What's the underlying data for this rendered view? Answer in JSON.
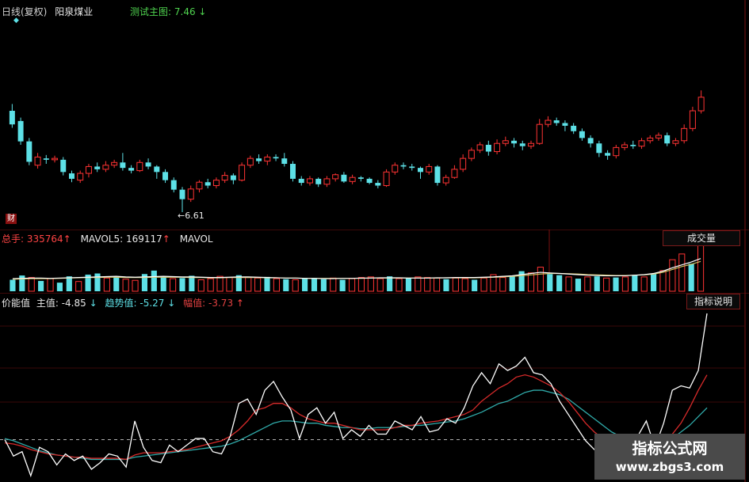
{
  "header": {
    "period_label": "日线(复权)",
    "stock_name": "阳泉煤业",
    "test_label": "测试主图:",
    "test_value": "7.46",
    "test_arrow": "↓"
  },
  "main_chart": {
    "low_marker": "←6.61",
    "cai_badge": "财",
    "candles": [
      [
        8.1,
        7.9,
        8.2,
        7.85
      ],
      [
        7.95,
        7.65,
        8.0,
        7.6
      ],
      [
        7.65,
        7.35,
        7.7,
        7.3
      ],
      [
        7.3,
        7.42,
        7.48,
        7.25
      ],
      [
        7.4,
        7.38,
        7.45,
        7.32
      ],
      [
        7.38,
        7.4,
        7.44,
        7.34
      ],
      [
        7.38,
        7.2,
        7.42,
        7.15
      ],
      [
        7.18,
        7.1,
        7.22,
        7.05
      ],
      [
        7.08,
        7.18,
        7.22,
        7.04
      ],
      [
        7.18,
        7.28,
        7.32,
        7.12
      ],
      [
        7.28,
        7.24,
        7.34,
        7.2
      ],
      [
        7.24,
        7.3,
        7.36,
        7.2
      ],
      [
        7.3,
        7.34,
        7.38,
        7.26
      ],
      [
        7.34,
        7.26,
        7.48,
        7.22
      ],
      [
        7.26,
        7.22,
        7.3,
        7.18
      ],
      [
        7.22,
        7.34,
        7.38,
        7.2
      ],
      [
        7.34,
        7.28,
        7.4,
        7.24
      ],
      [
        7.28,
        7.2,
        7.3,
        7.1
      ],
      [
        7.2,
        7.08,
        7.24,
        7.04
      ],
      [
        7.08,
        6.94,
        7.12,
        6.9
      ],
      [
        6.94,
        6.8,
        6.98,
        6.61
      ],
      [
        6.8,
        6.95,
        7.0,
        6.76
      ],
      [
        6.95,
        7.05,
        7.08,
        6.9
      ],
      [
        7.05,
        7.0,
        7.1,
        6.96
      ],
      [
        7.0,
        7.08,
        7.12,
        6.96
      ],
      [
        7.08,
        7.15,
        7.2,
        7.04
      ],
      [
        7.15,
        7.08,
        7.18,
        7.02
      ],
      [
        7.08,
        7.3,
        7.34,
        7.06
      ],
      [
        7.3,
        7.4,
        7.44,
        7.26
      ],
      [
        7.4,
        7.36,
        7.46,
        7.32
      ],
      [
        7.36,
        7.42,
        7.46,
        7.3
      ],
      [
        7.42,
        7.4,
        7.46,
        7.36
      ],
      [
        7.4,
        7.32,
        7.48,
        7.28
      ],
      [
        7.32,
        7.1,
        7.36,
        7.06
      ],
      [
        7.1,
        7.04,
        7.14,
        7.0
      ],
      [
        7.04,
        7.1,
        7.14,
        7.0
      ],
      [
        7.1,
        7.02,
        7.12,
        6.98
      ],
      [
        7.02,
        7.1,
        7.14,
        6.98
      ],
      [
        7.1,
        7.16,
        7.18,
        7.06
      ],
      [
        7.16,
        7.06,
        7.2,
        7.04
      ],
      [
        7.06,
        7.12,
        7.16,
        7.02
      ],
      [
        7.12,
        7.1,
        7.14,
        7.06
      ],
      [
        7.1,
        7.04,
        7.12,
        7.02
      ],
      [
        7.04,
        7.0,
        7.08,
        6.96
      ],
      [
        7.0,
        7.2,
        7.24,
        6.98
      ],
      [
        7.2,
        7.3,
        7.34,
        7.16
      ],
      [
        7.3,
        7.28,
        7.34,
        7.24
      ],
      [
        7.28,
        7.26,
        7.32,
        7.22
      ],
      [
        7.26,
        7.2,
        7.28,
        7.1
      ],
      [
        7.2,
        7.28,
        7.32,
        7.16
      ],
      [
        7.28,
        7.04,
        7.3,
        7.0
      ],
      [
        7.04,
        7.12,
        7.16,
        7.0
      ],
      [
        7.12,
        7.24,
        7.3,
        7.1
      ],
      [
        7.24,
        7.4,
        7.46,
        7.2
      ],
      [
        7.4,
        7.52,
        7.56,
        7.36
      ],
      [
        7.52,
        7.6,
        7.64,
        7.48
      ],
      [
        7.6,
        7.5,
        7.66,
        7.44
      ],
      [
        7.5,
        7.62,
        7.68,
        7.46
      ],
      [
        7.62,
        7.66,
        7.72,
        7.58
      ],
      [
        7.66,
        7.62,
        7.7,
        7.56
      ],
      [
        7.62,
        7.58,
        7.66,
        7.52
      ],
      [
        7.58,
        7.62,
        7.66,
        7.54
      ],
      [
        7.62,
        7.9,
        7.98,
        7.6
      ],
      [
        7.9,
        7.96,
        8.02,
        7.86
      ],
      [
        7.96,
        7.92,
        8.0,
        7.88
      ],
      [
        7.92,
        7.88,
        7.96,
        7.8
      ],
      [
        7.88,
        7.8,
        7.92,
        7.76
      ],
      [
        7.8,
        7.7,
        7.84,
        7.66
      ],
      [
        7.7,
        7.62,
        7.74,
        7.56
      ],
      [
        7.62,
        7.48,
        7.66,
        7.42
      ],
      [
        7.48,
        7.44,
        7.52,
        7.38
      ],
      [
        7.44,
        7.56,
        7.6,
        7.4
      ],
      [
        7.56,
        7.6,
        7.64,
        7.52
      ],
      [
        7.6,
        7.58,
        7.66,
        7.54
      ],
      [
        7.58,
        7.66,
        7.7,
        7.54
      ],
      [
        7.66,
        7.7,
        7.74,
        7.62
      ],
      [
        7.7,
        7.74,
        7.78,
        7.66
      ],
      [
        7.74,
        7.62,
        7.78,
        7.58
      ],
      [
        7.62,
        7.66,
        7.7,
        7.58
      ],
      [
        7.66,
        7.84,
        7.9,
        7.62
      ],
      [
        7.84,
        8.1,
        8.16,
        7.8
      ],
      [
        8.1,
        8.3,
        8.4,
        8.06
      ]
    ]
  },
  "volume": {
    "label_total": "总手: 335764",
    "label_total_arrow": "↑",
    "label_mavol": "MAVOL5: 169117",
    "label_mavol_arrow": "↑",
    "label_mavol2": "MAVOL",
    "button_label": "成交量",
    "bars": [
      [
        40,
        "dn"
      ],
      [
        55,
        "dn"
      ],
      [
        48,
        "up"
      ],
      [
        36,
        "dn"
      ],
      [
        44,
        "up"
      ],
      [
        30,
        "dn"
      ],
      [
        52,
        "dn"
      ],
      [
        34,
        "up"
      ],
      [
        58,
        "dn"
      ],
      [
        62,
        "dn"
      ],
      [
        46,
        "up"
      ],
      [
        50,
        "dn"
      ],
      [
        42,
        "up"
      ],
      [
        38,
        "up"
      ],
      [
        60,
        "dn"
      ],
      [
        72,
        "dn"
      ],
      [
        50,
        "dn"
      ],
      [
        44,
        "up"
      ],
      [
        46,
        "dn"
      ],
      [
        54,
        "dn"
      ],
      [
        40,
        "up"
      ],
      [
        44,
        "up"
      ],
      [
        52,
        "up"
      ],
      [
        48,
        "up"
      ],
      [
        56,
        "dn"
      ],
      [
        48,
        "up"
      ],
      [
        46,
        "up"
      ],
      [
        50,
        "dn"
      ],
      [
        44,
        "up"
      ],
      [
        42,
        "dn"
      ],
      [
        40,
        "up"
      ],
      [
        44,
        "dn"
      ],
      [
        46,
        "dn"
      ],
      [
        42,
        "dn"
      ],
      [
        46,
        "up"
      ],
      [
        40,
        "dn"
      ],
      [
        44,
        "up"
      ],
      [
        48,
        "up"
      ],
      [
        50,
        "up"
      ],
      [
        44,
        "up"
      ],
      [
        52,
        "dn"
      ],
      [
        44,
        "up"
      ],
      [
        46,
        "dn"
      ],
      [
        50,
        "up"
      ],
      [
        48,
        "up"
      ],
      [
        46,
        "up"
      ],
      [
        42,
        "dn"
      ],
      [
        46,
        "up"
      ],
      [
        44,
        "up"
      ],
      [
        40,
        "dn"
      ],
      [
        46,
        "up"
      ],
      [
        58,
        "up"
      ],
      [
        48,
        "up"
      ],
      [
        54,
        "dn"
      ],
      [
        70,
        "dn"
      ],
      [
        64,
        "up"
      ],
      [
        84,
        "up"
      ],
      [
        60,
        "dn"
      ],
      [
        56,
        "dn"
      ],
      [
        50,
        "up"
      ],
      [
        44,
        "dn"
      ],
      [
        50,
        "up"
      ],
      [
        52,
        "dn"
      ],
      [
        46,
        "up"
      ],
      [
        48,
        "dn"
      ],
      [
        50,
        "up"
      ],
      [
        56,
        "dn"
      ],
      [
        50,
        "up"
      ],
      [
        62,
        "dn"
      ],
      [
        72,
        "up"
      ],
      [
        110,
        "up"
      ],
      [
        130,
        "up"
      ],
      [
        96,
        "dn"
      ],
      [
        160,
        "up"
      ]
    ],
    "mavol_line": [
      44,
      45,
      46,
      46,
      45,
      46,
      47,
      48,
      49,
      50,
      51,
      52,
      50,
      49,
      50,
      51,
      52,
      51,
      50,
      50,
      49,
      48,
      48,
      49,
      50,
      50,
      49,
      48,
      47,
      46,
      46,
      45,
      45,
      44,
      44,
      45,
      45,
      46,
      46,
      47,
      47,
      47,
      46,
      46,
      46,
      47,
      47,
      48,
      48,
      48,
      49,
      50,
      52,
      54,
      58,
      62,
      66,
      64,
      62,
      60,
      58,
      56,
      55,
      54,
      54,
      54,
      56,
      58,
      62,
      70,
      82,
      92,
      102,
      114
    ],
    "ma2_line": [
      42,
      43,
      44,
      44,
      44,
      45,
      46,
      47,
      48,
      48,
      49,
      49,
      48,
      48,
      48,
      49,
      49,
      49,
      49,
      48,
      48,
      47,
      47,
      48,
      48,
      48,
      48,
      47,
      47,
      46,
      46,
      45,
      45,
      45,
      45,
      45,
      45,
      45,
      46,
      46,
      46,
      46,
      46,
      46,
      46,
      46,
      47,
      47,
      47,
      47,
      48,
      49,
      50,
      52,
      54,
      57,
      60,
      62,
      62,
      61,
      60,
      58,
      57,
      56,
      55,
      55,
      56,
      57,
      60,
      66,
      76,
      86,
      94,
      104
    ]
  },
  "indicator": {
    "label_name": "价能值",
    "label_main": "主值:",
    "label_main_value": "-4.85",
    "label_main_arrow": "↓",
    "label_trend": "趋势值:",
    "label_trend_value": "-5.27",
    "label_trend_arrow": "↓",
    "label_amp": "幅值:",
    "label_amp_value": "-3.73",
    "label_amp_arrow": "↑",
    "button_label": "指标说明",
    "white_line": [
      -3.5,
      -5.0,
      -4.6,
      -6.8,
      -4.2,
      -4.6,
      -5.8,
      -4.8,
      -5.4,
      -5.0,
      -6.2,
      -5.6,
      -4.8,
      -5.0,
      -6.0,
      -1.8,
      -4.2,
      -5.4,
      -5.6,
      -4.0,
      -4.6,
      -4.0,
      -3.4,
      -3.4,
      -4.6,
      -4.8,
      -3.2,
      -0.2,
      0.2,
      -1.2,
      1.0,
      1.8,
      0.4,
      -0.8,
      -3.4,
      -1.2,
      -0.6,
      -2.0,
      -1.0,
      -3.4,
      -2.6,
      -3.2,
      -2.2,
      -3.0,
      -3.0,
      -1.8,
      -2.2,
      -2.6,
      -1.4,
      -2.8,
      -2.6,
      -1.6,
      -2.0,
      -0.6,
      1.4,
      2.6,
      1.6,
      3.4,
      2.8,
      3.2,
      4.0,
      2.6,
      2.4,
      1.6,
      0.0,
      -1.2,
      -2.4,
      -3.6,
      -4.4,
      -4.0,
      -3.6,
      -4.4,
      -4.6,
      -3.2,
      -1.8,
      -4.2,
      -2.0,
      1.0,
      1.4,
      1.2,
      2.8,
      8.0
    ],
    "red_line": [
      -3.8,
      -3.9,
      -4.1,
      -4.4,
      -4.6,
      -4.8,
      -4.9,
      -5.0,
      -5.1,
      -5.1,
      -5.2,
      -5.2,
      -5.2,
      -5.2,
      -5.3,
      -4.9,
      -4.7,
      -4.7,
      -4.7,
      -4.6,
      -4.5,
      -4.4,
      -4.2,
      -4.0,
      -3.8,
      -3.6,
      -3.2,
      -2.6,
      -1.8,
      -0.8,
      -0.6,
      -0.2,
      -0.2,
      -0.6,
      -1.2,
      -1.6,
      -1.8,
      -2.0,
      -2.0,
      -2.2,
      -2.4,
      -2.6,
      -2.6,
      -2.6,
      -2.6,
      -2.4,
      -2.2,
      -2.2,
      -2.0,
      -1.9,
      -1.8,
      -1.6,
      -1.4,
      -1.2,
      -0.8,
      0.0,
      0.6,
      1.2,
      1.6,
      2.2,
      2.4,
      2.2,
      1.8,
      1.4,
      0.8,
      0.0,
      -1.0,
      -2.0,
      -2.8,
      -3.4,
      -3.8,
      -4.0,
      -4.2,
      -4.2,
      -4.0,
      -4.0,
      -3.8,
      -3.0,
      -2.0,
      -0.6,
      1.0,
      2.4
    ],
    "cyan_line": [
      -3.4,
      -3.6,
      -3.9,
      -4.2,
      -4.5,
      -4.7,
      -4.9,
      -5.0,
      -5.1,
      -5.2,
      -5.3,
      -5.3,
      -5.3,
      -5.3,
      -5.3,
      -5.1,
      -5.0,
      -4.9,
      -4.8,
      -4.7,
      -4.6,
      -4.5,
      -4.4,
      -4.3,
      -4.2,
      -4.1,
      -3.9,
      -3.6,
      -3.2,
      -2.8,
      -2.4,
      -2.0,
      -1.8,
      -1.8,
      -1.9,
      -2.0,
      -2.0,
      -2.2,
      -2.3,
      -2.4,
      -2.4,
      -2.5,
      -2.5,
      -2.4,
      -2.4,
      -2.4,
      -2.3,
      -2.2,
      -2.2,
      -2.1,
      -2.0,
      -1.9,
      -1.8,
      -1.6,
      -1.3,
      -1.0,
      -0.6,
      -0.2,
      0.0,
      0.4,
      0.8,
      1.0,
      1.0,
      0.8,
      0.6,
      0.2,
      -0.4,
      -1.0,
      -1.6,
      -2.2,
      -2.8,
      -3.2,
      -3.6,
      -3.8,
      -3.8,
      -3.9,
      -3.8,
      -3.4,
      -2.8,
      -2.2,
      -1.4,
      -0.6
    ]
  },
  "watermark": {
    "cn": "指标公式网",
    "url": "www.zbgs3.com"
  },
  "colors": {
    "up": "#ff3333",
    "down": "#5de0e6",
    "grid": "#7a1111",
    "white_line": "#ffffff",
    "red_line": "#d62a2a",
    "cyan_line": "#2fa9a8"
  }
}
